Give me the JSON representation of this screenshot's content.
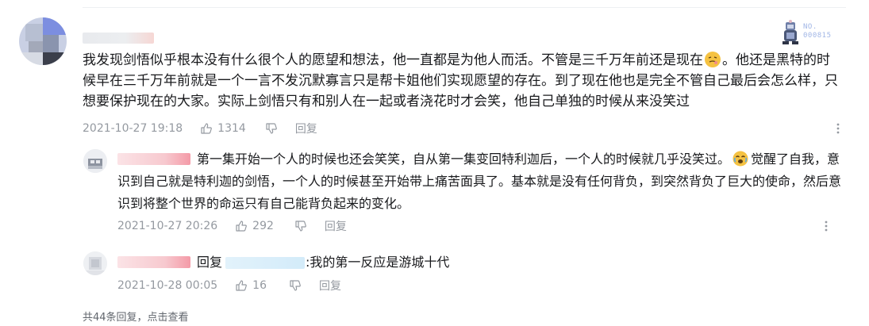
{
  "comment": {
    "medal_no": "NO.\n000815",
    "text_parts": [
      "我发现剑悟似乎根本没有什么很个人的愿望和想法，他一直都是为他人而活。不管是三千万年前还是现在",
      "。他还是黑特的时候早在三千万年前就是一个一言不发沉默寡言只是帮卡姐他们实现愿望的存在。到了现在他也是完全不管自己最后会怎么样，只想要保护现在的大家。实际上剑悟只有和别人在一起或者浇花时才会笑，他自己单独的时候从来没笑过"
    ],
    "time": "2021-10-27 19:18",
    "likes": "1314",
    "reply_label": "回复"
  },
  "replies": [
    {
      "text_parts": [
        "第一集开始一个人的时候也还会笑笑，自从第一集变回特利迦后，一个人的时候就几乎没笑过。",
        "觉醒了自我，意识到自己就是特利迦的剑悟，一个人的时候甚至开始带上痛苦面具了。基本就是没有任何背负，到突然背负了巨大的使命，然后意识到将整个世界的命运只有自己能背负起来的变化。"
      ],
      "time": "2021-10-27 20:26",
      "likes": "292",
      "reply_label": "回复"
    },
    {
      "reply_prefix": "回复",
      "text": ":我的第一反应是游城十代",
      "time": "2021-10-28 00:05",
      "likes": "16",
      "reply_label": "回复"
    }
  ],
  "footer": {
    "count_text": "共44条回复，",
    "view_link": "点击查看"
  },
  "icons": {
    "like": "thumbs-up-icon",
    "dislike": "thumbs-down-icon",
    "more": "more-vertical-icon"
  },
  "colors": {
    "meta_gray": "#9499a0",
    "text": "#18191c"
  }
}
